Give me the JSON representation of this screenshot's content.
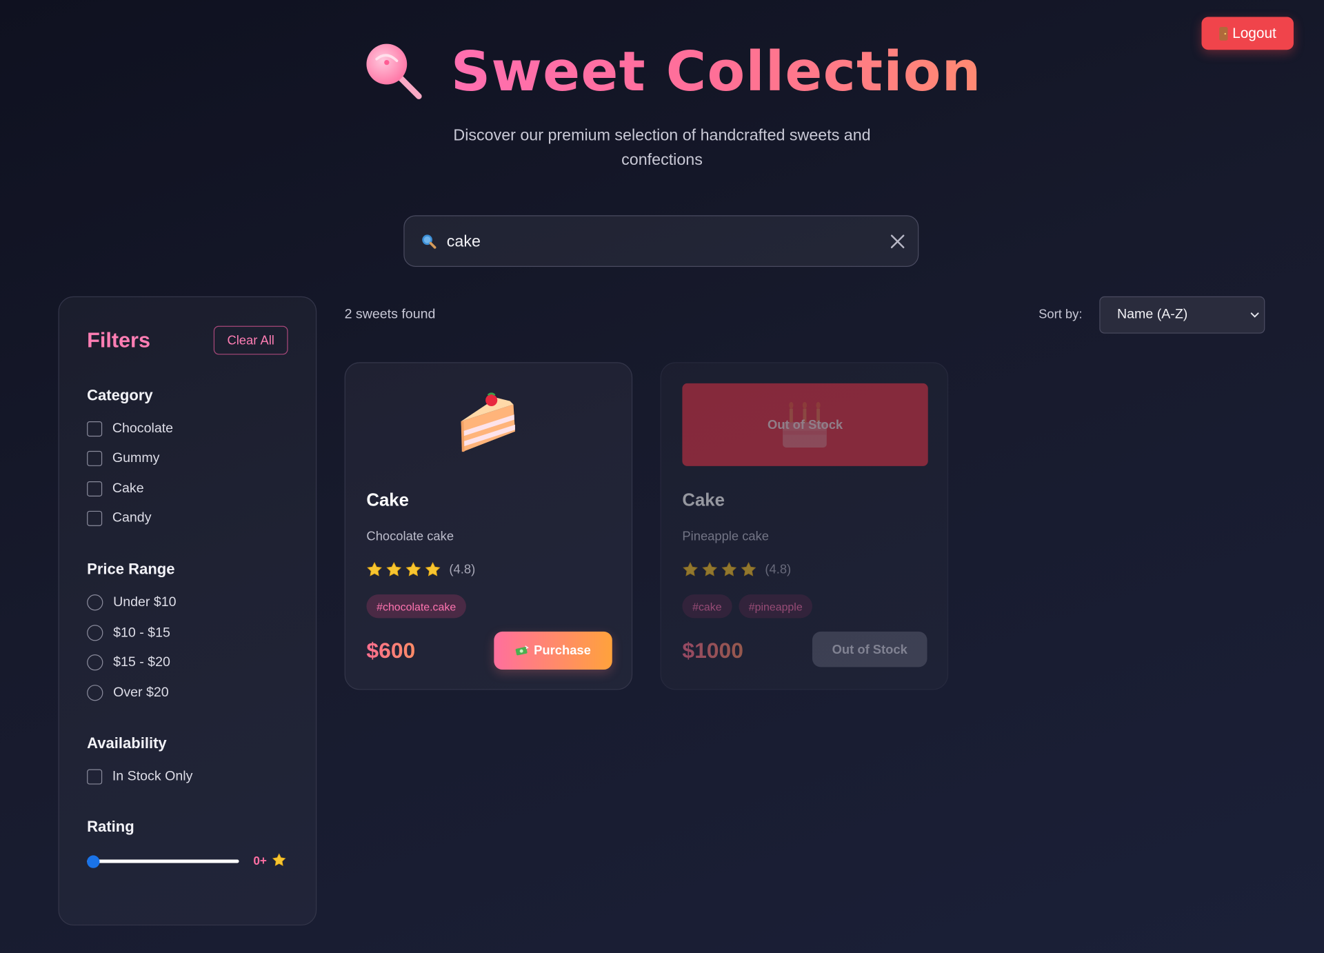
{
  "header": {
    "logout_label": "Logout",
    "title": "Sweet Collection",
    "subtitle": "Discover our premium selection of handcrafted sweets and confections"
  },
  "search": {
    "value": "cake",
    "placeholder": ""
  },
  "filters": {
    "title": "Filters",
    "clear_all_label": "Clear All",
    "category": {
      "heading": "Category",
      "options": [
        "Chocolate",
        "Gummy",
        "Cake",
        "Candy"
      ]
    },
    "price_range": {
      "heading": "Price Range",
      "options": [
        "Under $10",
        "$10 - $15",
        "$15 - $20",
        "Over $20"
      ]
    },
    "availability": {
      "heading": "Availability",
      "option": "In Stock Only"
    },
    "rating": {
      "heading": "Rating",
      "value_label": "0+",
      "value": 0,
      "max": 5
    }
  },
  "results": {
    "count_text": "2 sweets found",
    "sort_label": "Sort by:",
    "sort_value": "Name (A-Z)"
  },
  "products": [
    {
      "name": "Cake",
      "description": "Chocolate cake",
      "rating_text": "(4.8)",
      "stars": 4,
      "tags": [
        "#chocolate.cake"
      ],
      "price": "$600",
      "action_label": "Purchase",
      "in_stock": true,
      "icon": "cake-slice-icon"
    },
    {
      "name": "Cake",
      "description": "Pineapple cake",
      "rating_text": "(4.8)",
      "stars": 4,
      "tags": [
        "#cake",
        "#pineapple"
      ],
      "price": "$1000",
      "action_label": "Out of Stock",
      "overlay_label": "Out of Stock",
      "in_stock": false,
      "icon": "birthday-cake-icon"
    }
  ],
  "colors": {
    "accent_pink": "#ff7eb4",
    "logout_red": "#f0444b",
    "star_gold": "#f7c531",
    "out_of_stock_red": "#e0384a"
  }
}
